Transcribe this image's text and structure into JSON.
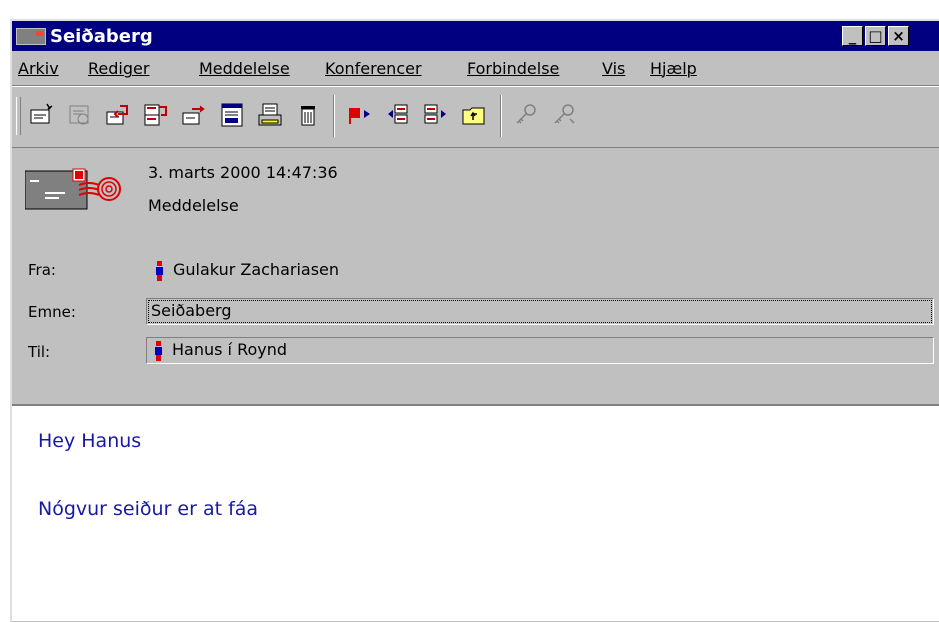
{
  "window": {
    "title": "Seiðaberg",
    "controls": [
      "minimize",
      "maximize",
      "close"
    ]
  },
  "menu": {
    "items": [
      "Arkiv",
      "Rediger",
      "Meddelelse",
      "Konferencer",
      "Forbindelse",
      "Vis",
      "Hjælp"
    ]
  },
  "toolbar": {
    "buttons": [
      "new-message-icon",
      "reply-all-icon",
      "reply-icon",
      "forward-icon",
      "redirect-icon",
      "print-preview-icon",
      "print-icon",
      "delete-icon",
      "flag-icon",
      "previous-icon",
      "next-icon",
      "folder-up-icon",
      "key-icon",
      "key-disabled-icon"
    ]
  },
  "header": {
    "datetime": "3. marts 2000 14:47:36",
    "type": "Meddelelse",
    "from_label": "Fra:",
    "from_value": "Gulakur Zachariasen",
    "subject_label": "Emne:",
    "subject_value": "Seiðaberg",
    "to_label": "Til:",
    "to_value": "Hanus í Roynd"
  },
  "body": {
    "lines": [
      "Hey Hanus",
      "Nógvur seiður er at fáa"
    ]
  },
  "colors": {
    "titlebar": "#000080",
    "chrome": "#c0c0c0",
    "body_text": "#1818a8"
  }
}
